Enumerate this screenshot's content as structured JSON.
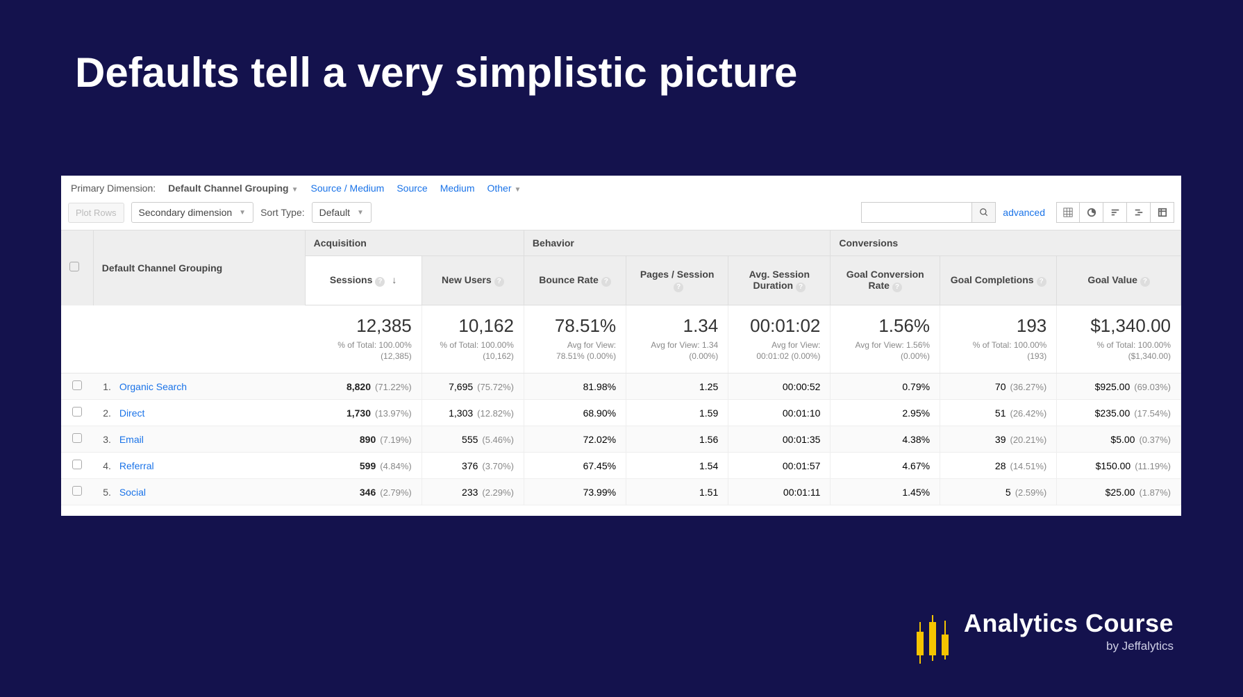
{
  "slide": {
    "title": "Defaults tell a very simplistic picture"
  },
  "primaryDimension": {
    "label": "Primary Dimension:",
    "active": "Default Channel Grouping",
    "options": [
      "Source / Medium",
      "Source",
      "Medium",
      "Other"
    ]
  },
  "toolbar": {
    "plotRows": "Plot Rows",
    "secondaryDimension": "Secondary dimension",
    "sortTypeLabel": "Sort Type:",
    "sortTypeValue": "Default",
    "advanced": "advanced"
  },
  "columns": {
    "dimension": "Default Channel Grouping",
    "groups": {
      "acquisition": "Acquisition",
      "behavior": "Behavior",
      "conversions": "Conversions"
    },
    "sessions": "Sessions",
    "newUsers": "New Users",
    "bounceRate": "Bounce Rate",
    "pagesPerSession": "Pages / Session",
    "avgSessionDuration": "Avg. Session Duration",
    "goalConversionRate": "Goal Conversion Rate",
    "goalCompletions": "Goal Completions",
    "goalValue": "Goal Value"
  },
  "totals": {
    "sessions": {
      "value": "12,385",
      "sub1": "% of Total: 100.00%",
      "sub2": "(12,385)"
    },
    "newUsers": {
      "value": "10,162",
      "sub1": "% of Total: 100.00%",
      "sub2": "(10,162)"
    },
    "bounceRate": {
      "value": "78.51%",
      "sub1": "Avg for View:",
      "sub2": "78.51% (0.00%)"
    },
    "pagesPerSession": {
      "value": "1.34",
      "sub1": "Avg for View: 1.34",
      "sub2": "(0.00%)"
    },
    "avgSessionDuration": {
      "value": "00:01:02",
      "sub1": "Avg for View:",
      "sub2": "00:01:02 (0.00%)"
    },
    "goalConversionRate": {
      "value": "1.56%",
      "sub1": "Avg for View: 1.56%",
      "sub2": "(0.00%)"
    },
    "goalCompletions": {
      "value": "193",
      "sub1": "% of Total: 100.00%",
      "sub2": "(193)"
    },
    "goalValue": {
      "value": "$1,340.00",
      "sub1": "% of Total: 100.00%",
      "sub2": "($1,340.00)"
    }
  },
  "rows": [
    {
      "n": "1.",
      "channel": "Organic Search",
      "sessions": "8,820",
      "sessionsPct": "(71.22%)",
      "newUsers": "7,695",
      "newUsersPct": "(75.72%)",
      "bounce": "81.98%",
      "pps": "1.25",
      "dur": "00:00:52",
      "gcr": "0.79%",
      "gc": "70",
      "gcPct": "(36.27%)",
      "gv": "$925.00",
      "gvPct": "(69.03%)"
    },
    {
      "n": "2.",
      "channel": "Direct",
      "sessions": "1,730",
      "sessionsPct": "(13.97%)",
      "newUsers": "1,303",
      "newUsersPct": "(12.82%)",
      "bounce": "68.90%",
      "pps": "1.59",
      "dur": "00:01:10",
      "gcr": "2.95%",
      "gc": "51",
      "gcPct": "(26.42%)",
      "gv": "$235.00",
      "gvPct": "(17.54%)"
    },
    {
      "n": "3.",
      "channel": "Email",
      "sessions": "890",
      "sessionsPct": "(7.19%)",
      "newUsers": "555",
      "newUsersPct": "(5.46%)",
      "bounce": "72.02%",
      "pps": "1.56",
      "dur": "00:01:35",
      "gcr": "4.38%",
      "gc": "39",
      "gcPct": "(20.21%)",
      "gv": "$5.00",
      "gvPct": "(0.37%)"
    },
    {
      "n": "4.",
      "channel": "Referral",
      "sessions": "599",
      "sessionsPct": "(4.84%)",
      "newUsers": "376",
      "newUsersPct": "(3.70%)",
      "bounce": "67.45%",
      "pps": "1.54",
      "dur": "00:01:57",
      "gcr": "4.67%",
      "gc": "28",
      "gcPct": "(14.51%)",
      "gv": "$150.00",
      "gvPct": "(11.19%)"
    },
    {
      "n": "5.",
      "channel": "Social",
      "sessions": "346",
      "sessionsPct": "(2.79%)",
      "newUsers": "233",
      "newUsersPct": "(2.29%)",
      "bounce": "73.99%",
      "pps": "1.51",
      "dur": "00:01:11",
      "gcr": "1.45%",
      "gc": "5",
      "gcPct": "(2.59%)",
      "gv": "$25.00",
      "gvPct": "(1.87%)"
    }
  ],
  "footer": {
    "brand": "Analytics Course",
    "byline": "by Jeffalytics"
  }
}
